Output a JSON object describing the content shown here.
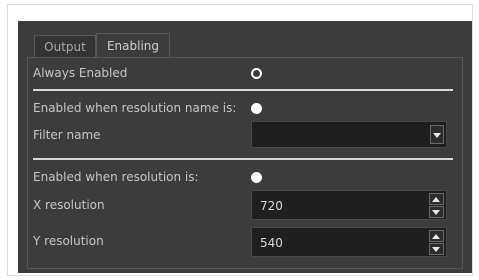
{
  "tabs": [
    {
      "label": "Output",
      "active": false
    },
    {
      "label": "Enabling",
      "active": true
    }
  ],
  "always_enabled": {
    "label": "Always Enabled",
    "selected": true
  },
  "name_section": {
    "radio_label": "Enabled when resolution name is:",
    "selected": false,
    "filter_label": "Filter name",
    "filter_value": ""
  },
  "res_section": {
    "radio_label": "Enabled when resolution is:",
    "selected": false,
    "x_label": "X resolution",
    "x_value": "720",
    "y_label": "Y resolution",
    "y_value": "540"
  },
  "icons": {
    "dropdown": "chevron-down-icon",
    "spin_up": "spin-up-icon",
    "spin_down": "spin-down-icon"
  },
  "colors": {
    "panel_bg": "#3c3c3c",
    "field_bg": "#1f1f1f",
    "text": "#c8c8c8",
    "radio": "#ffffff"
  }
}
